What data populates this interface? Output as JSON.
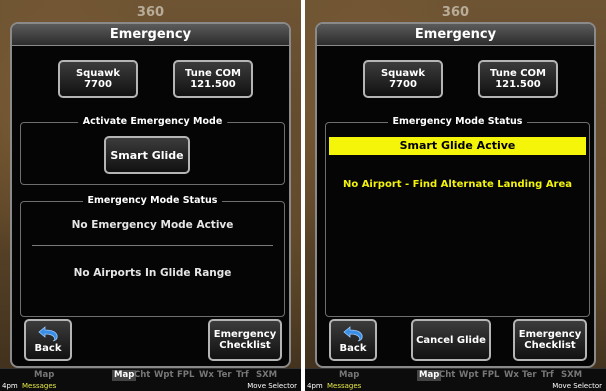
{
  "colors": {
    "alert_yellow": "#f5f50a",
    "dialog_bg": "#050505",
    "button_border": "#b5b5b5"
  },
  "left": {
    "heading": "360",
    "title": "Emergency",
    "squawk": {
      "label": "Squawk",
      "value": "7700"
    },
    "tune_com": {
      "label": "Tune COM",
      "value": "121.500"
    },
    "activate_group": "Activate Emergency Mode",
    "smart_glide_button": "Smart Glide",
    "status_group": "Emergency Mode Status",
    "status": "No Emergency Mode Active",
    "glide_status": "No Airports In Glide Range",
    "back_button": "Back",
    "checklist_button": {
      "line1": "Emergency",
      "line2": "Checklist"
    },
    "tabs": [
      "Map",
      "Map",
      "Cht",
      "Wpt",
      "FPL",
      "Wx",
      "Ter",
      "Trf",
      "SXM"
    ],
    "footer": {
      "left1": "4pm",
      "left2": "Messages",
      "right": "Move Selector"
    }
  },
  "right": {
    "heading": "360",
    "title": "Emergency",
    "squawk": {
      "label": "Squawk",
      "value": "7700"
    },
    "tune_com": {
      "label": "Tune COM",
      "value": "121.500"
    },
    "status_group": "Emergency Mode Status",
    "active_banner": "Smart Glide Active",
    "airport_warning": "No Airport - Find Alternate Landing Area",
    "back_button": "Back",
    "cancel_button": "Cancel Glide",
    "checklist_button": {
      "line1": "Emergency",
      "line2": "Checklist"
    },
    "tabs": [
      "Map",
      "Map",
      "Cht",
      "Wpt",
      "FPL",
      "Wx",
      "Ter",
      "Trf",
      "SXM"
    ],
    "footer": {
      "left1": "4pm",
      "left2": "Messages",
      "right": "Move Selector"
    }
  }
}
